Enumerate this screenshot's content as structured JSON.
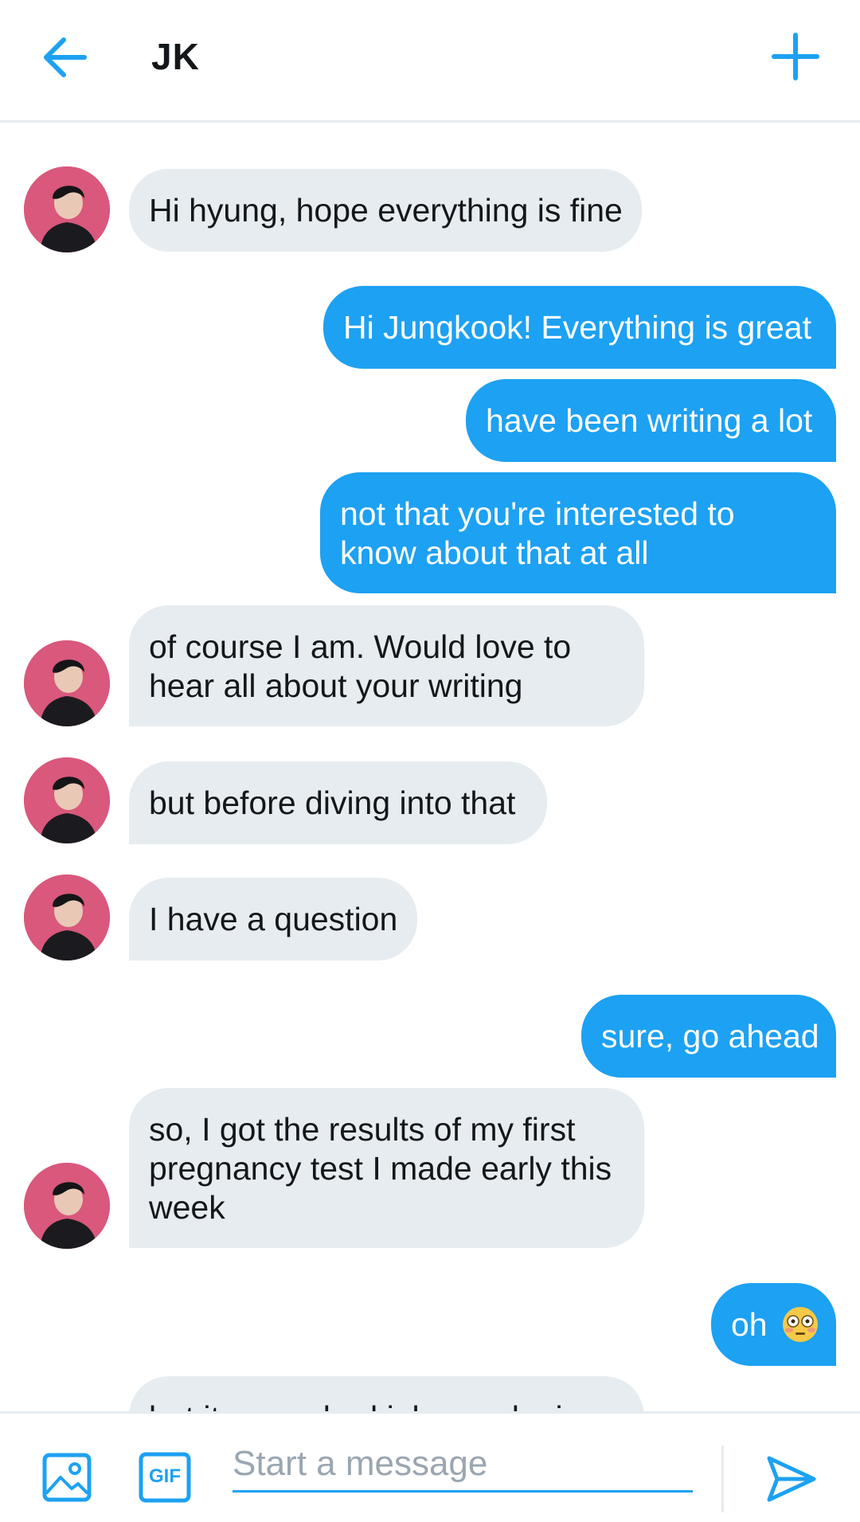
{
  "header": {
    "title": "JK"
  },
  "composer": {
    "placeholder": "Start a message",
    "gif_label": "GIF"
  },
  "colors": {
    "accent": "#1da1f2",
    "incoming_bubble": "#e6ecf0",
    "avatar_bg": "#d9587c"
  },
  "messages": [
    {
      "from": "them",
      "text": "Hi hyung, hope everything is fine"
    },
    {
      "from": "me",
      "text": "Hi Jungkook! Everything is great"
    },
    {
      "from": "me",
      "text": "have been writing a lot"
    },
    {
      "from": "me",
      "lines": [
        "not that you're interested to",
        "know about that at all"
      ]
    },
    {
      "from": "them",
      "lines": [
        "of course I am. Would love to",
        "hear all about your writing"
      ]
    },
    {
      "from": "them",
      "text": "but before diving into that"
    },
    {
      "from": "them",
      "text": "I have a question"
    },
    {
      "from": "me",
      "text": "sure, go ahead"
    },
    {
      "from": "them",
      "lines": [
        "so, I got the results of my first",
        "pregnancy test I made early this",
        "week"
      ]
    },
    {
      "from": "me",
      "text": "oh",
      "emoji": "flushed-face"
    },
    {
      "from": "them",
      "text": "but it was a bad joke, and a in..."
    }
  ]
}
